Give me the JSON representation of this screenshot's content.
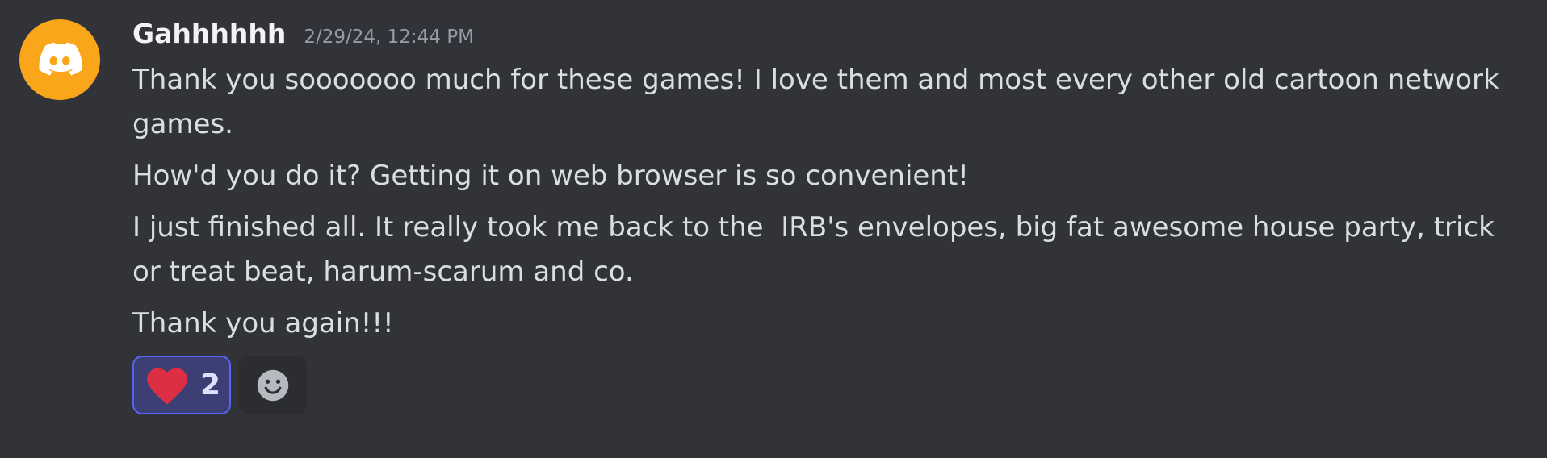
{
  "message": {
    "author": "Gahhhhhh",
    "timestamp": "2/29/24, 12:44 PM",
    "avatar_icon": "discord-logo-icon",
    "avatar_color": "#faa61a",
    "paragraphs": [
      "Thank you sooooooo much for these games! I love them and most every other old cartoon network games.",
      "How'd you do it? Getting it on web browser is so convenient!",
      "I just finished all. It really took me back to the  IRB's envelopes, big fat awesome house party, trick or treat beat, harum-scarum and co.",
      "Thank you again!!!"
    ],
    "reactions": [
      {
        "emoji": "heart-icon",
        "count": "2",
        "selected": true
      }
    ],
    "add_reaction_icon": "smiley-add-reaction-icon"
  },
  "colors": {
    "background": "#313338",
    "reaction_active_bg": "#3b3f74",
    "reaction_active_border": "#5865f2",
    "heart": "#dd2e44"
  }
}
